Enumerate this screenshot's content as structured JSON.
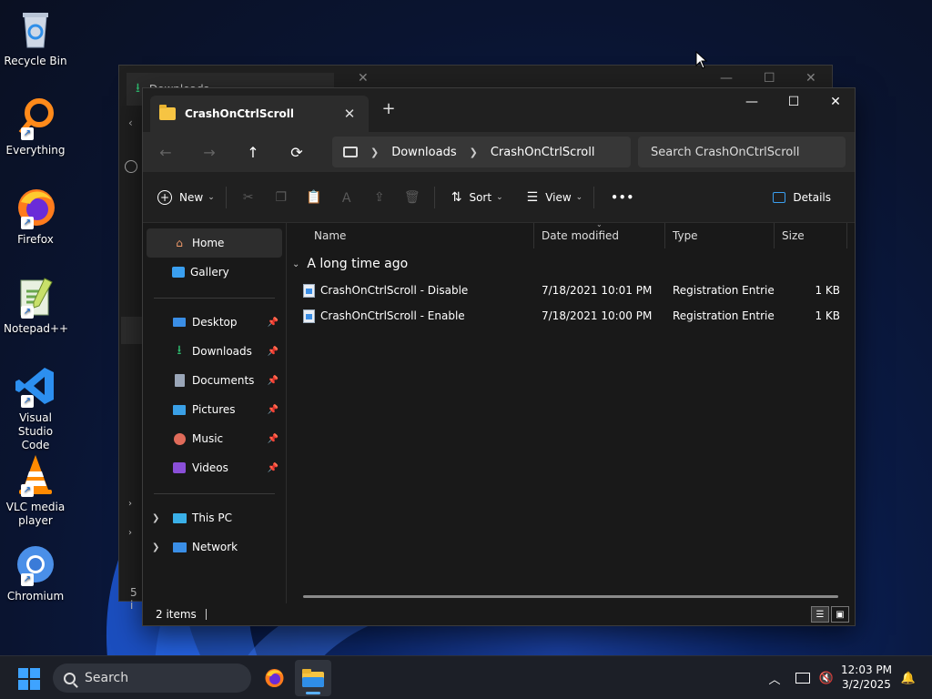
{
  "desktop": {
    "icons": [
      {
        "label": "Recycle Bin",
        "icon": "recycle-bin-icon"
      },
      {
        "label": "Everything",
        "icon": "everything-icon"
      },
      {
        "label": "Firefox",
        "icon": "firefox-icon"
      },
      {
        "label": "Notepad++",
        "icon": "notepad-plus-plus-icon"
      },
      {
        "label": "Visual Studio Code",
        "icon": "vscode-icon"
      },
      {
        "label": "VLC media player",
        "icon": "vlc-icon"
      },
      {
        "label": "Chromium",
        "icon": "chromium-icon"
      }
    ]
  },
  "background_window": {
    "tab_title": "Downloads",
    "status_fragment": "5 i"
  },
  "window": {
    "tab_title": "CrashOnCtrlScroll",
    "breadcrumb": [
      "Downloads",
      "CrashOnCtrlScroll"
    ],
    "search_placeholder": "Search CrashOnCtrlScroll",
    "toolbar": {
      "new_label": "New",
      "sort_label": "Sort",
      "view_label": "View",
      "more_label": "•••",
      "details_label": "Details"
    },
    "nav": {
      "home": "Home",
      "gallery": "Gallery",
      "quick_access": [
        {
          "label": "Desktop",
          "icon": "desktop-icon",
          "color": "#3a8ee6"
        },
        {
          "label": "Downloads",
          "icon": "download-icon",
          "color": "#2fbf71"
        },
        {
          "label": "Documents",
          "icon": "documents-icon",
          "color": "#9aa6b8"
        },
        {
          "label": "Pictures",
          "icon": "pictures-icon",
          "color": "#3aa0e6"
        },
        {
          "label": "Music",
          "icon": "music-icon",
          "color": "#e06b5a"
        },
        {
          "label": "Videos",
          "icon": "videos-icon",
          "color": "#8a4fd8"
        }
      ],
      "this_pc": "This PC",
      "network": "Network"
    },
    "columns": {
      "name": "Name",
      "date": "Date modified",
      "type": "Type",
      "size": "Size"
    },
    "group_label": "A long time ago",
    "files": [
      {
        "name": "CrashOnCtrlScroll - Disable",
        "date": "7/18/2021 10:01 PM",
        "type": "Registration Entries",
        "size": "1 KB"
      },
      {
        "name": "CrashOnCtrlScroll - Enable",
        "date": "7/18/2021 10:00 PM",
        "type": "Registration Entries",
        "size": "1 KB"
      }
    ],
    "status": "2 items"
  },
  "taskbar": {
    "search_label": "Search",
    "time": "12:03 PM",
    "date": "3/2/2025"
  }
}
